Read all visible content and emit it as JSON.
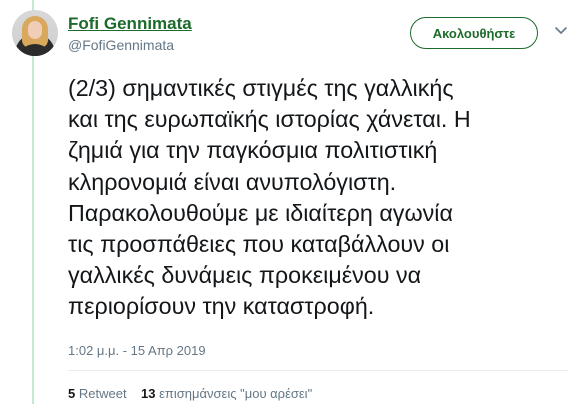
{
  "user": {
    "name": "Fofi Gennimata",
    "handle": "@FofiGennimata"
  },
  "header": {
    "follow_label": "Ακολουθήστε"
  },
  "tweet": {
    "text": "(2/3) σημαντικές στιγμές της γαλλικής\nκαι της ευρωπαϊκής ιστορίας χάνεται. Η\nζημιά για την παγκόσμια πολιτιστική\nκληρονομιά είναι ανυπολόγιστη.\nΠαρακολουθούμε με ιδιαίτερη αγωνία\nτις προσπάθειες που καταβάλλουν οι\nγαλλικές δυνάμεις προκειμένου να\nπεριορίσουν την καταστροφή.",
    "timestamp": "1:02 μ.μ. - 15 Απρ 2019"
  },
  "stats": {
    "retweet_count": "5",
    "retweet_label": "Retweet",
    "likes_count": "13",
    "likes_label": "επισημάνσεις \"μου αρέσει\""
  },
  "colors": {
    "accent": "#1c6b2b",
    "rail": "#c5e8cf",
    "muted": "#657786"
  },
  "icons": {
    "menu": "chevron-down-icon"
  }
}
